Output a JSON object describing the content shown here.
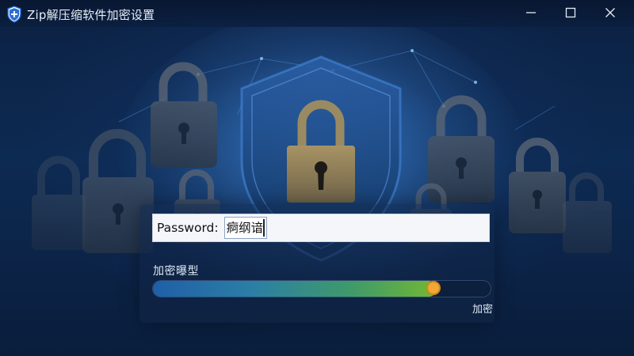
{
  "window": {
    "title": "Zip解压缩软件加密设置",
    "app_icon": "shield-plus-icon",
    "controls": [
      "minimize-icon",
      "maximize-icon",
      "close-icon"
    ]
  },
  "form": {
    "password_label": "Password: ",
    "password_value": "痾纲谙",
    "encryption_type_label": "加密曝型",
    "slider_end_label": "加密",
    "slider_level": 0.83
  },
  "colors": {
    "background": "#0c2143",
    "accent_thumb": "#f0a934",
    "fill_start": "#1f5fa8",
    "fill_end": "#72b834"
  }
}
